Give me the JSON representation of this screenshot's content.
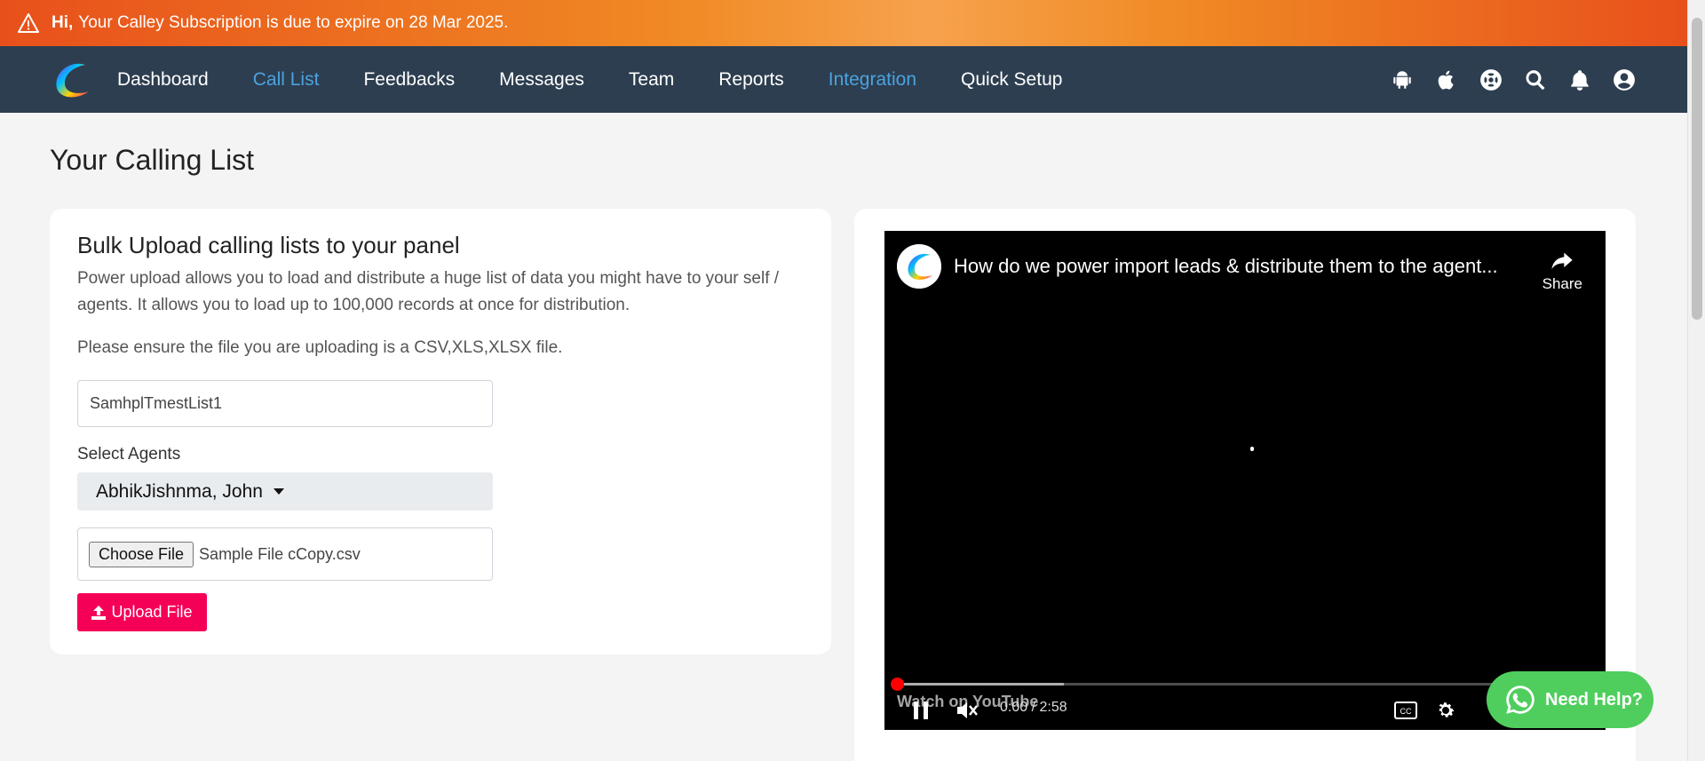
{
  "banner": {
    "greeting": "Hi,",
    "message": "Your Calley Subscription is due to expire on 28 Mar 2025."
  },
  "nav": {
    "items": [
      {
        "label": "Dashboard",
        "active": false
      },
      {
        "label": "Call List",
        "active": true
      },
      {
        "label": "Feedbacks",
        "active": false
      },
      {
        "label": "Messages",
        "active": false
      },
      {
        "label": "Team",
        "active": false
      },
      {
        "label": "Reports",
        "active": false
      },
      {
        "label": "Integration",
        "active": true
      },
      {
        "label": "Quick Setup",
        "active": false
      }
    ],
    "icons": [
      "android-icon",
      "apple-icon",
      "support-icon",
      "search-icon",
      "bell-icon",
      "user-icon"
    ]
  },
  "page": {
    "title": "Your Calling List"
  },
  "upload": {
    "heading": "Bulk Upload calling lists to your panel",
    "description": "Power upload allows you to load and distribute a huge list of data you might have to your self / agents. It allows you to load up to 100,000 records at once for distribution.",
    "note": "Please ensure the file you are uploading is a CSV,XLS,XLSX file.",
    "list_name_value": "SamhplTmestList1",
    "agents_label": "Select Agents",
    "agents_selected": "AbhikJishnma, John",
    "choose_file_label": "Choose File",
    "file_name": "Sample File cCopy.csv",
    "upload_label": "Upload File"
  },
  "video": {
    "title": "How do we power import leads & distribute them to the agent...",
    "share_label": "Share",
    "watch_on": "Watch on",
    "youtube": "YouTube",
    "time": "0:00 / 2:58"
  },
  "help": {
    "label": "Need Help?"
  },
  "colors": {
    "nav_bg": "#2d3e50",
    "active_link": "#4aa3df",
    "upload_btn": "#f50057",
    "help_btn": "#4fce5d"
  }
}
